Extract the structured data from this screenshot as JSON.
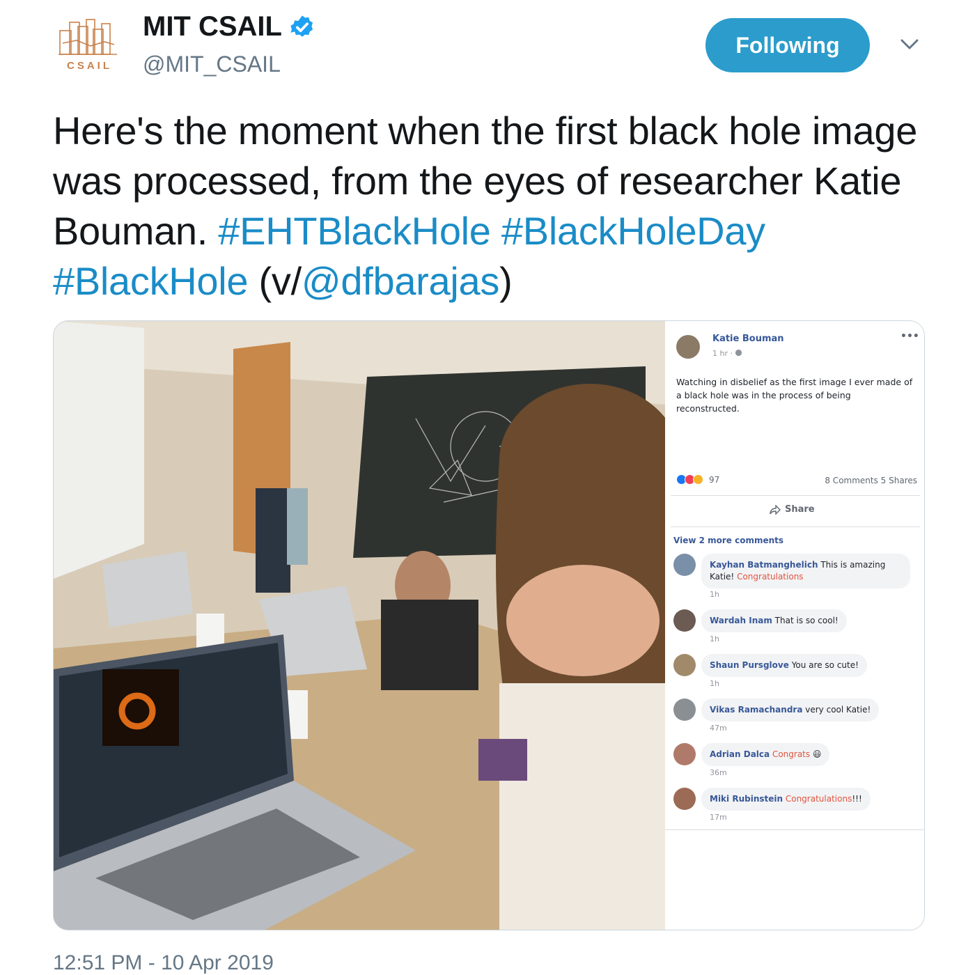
{
  "account": {
    "logo_text": "CSAIL",
    "display_name": "MIT CSAIL",
    "handle": "@MIT_CSAIL",
    "verified_icon": "verified-badge-icon",
    "follow_label": "Following"
  },
  "tweet": {
    "text_plain_1": "Here's the moment when the first black hole image was processed, from the eyes of researcher Katie Bouman. ",
    "hashtag_1": "#EHTBlackHole",
    "hashtag_2": "#BlackHoleDay",
    "hashtag_3": "#BlackHole",
    "text_via_open": " (v/",
    "mention": "@dfbarajas",
    "text_via_close": ")",
    "timestamp": "12:51 PM - 10 Apr 2019"
  },
  "fb_post": {
    "author": "Katie Bouman",
    "time": "1 hr · ",
    "more": "•••",
    "body": "Watching in disbelief as the first image I ever made of a black hole was in the process of being reconstructed.",
    "reaction_count": "97",
    "stats": "8 Comments  5 Shares",
    "share_label": "Share",
    "view_more": "View 2 more comments",
    "comments": [
      {
        "name": "Kayhan Batmanghelich",
        "text": "This is amazing Katie!",
        "red": "Congratulations",
        "time": "1h"
      },
      {
        "name": "Wardah Inam",
        "text": "That is so cool!",
        "red": "",
        "time": "1h"
      },
      {
        "name": "Shaun Pursglove",
        "text": "You are so cute!",
        "red": "",
        "time": "1h"
      },
      {
        "name": "Vikas Ramachandra",
        "text": "very cool Katie!",
        "red": "",
        "time": "47m"
      },
      {
        "name": "Adrian Dalca",
        "text": "",
        "red": "Congrats",
        "emoji": "😃",
        "time": "36m"
      },
      {
        "name": "Miki Rubinstein",
        "text": "",
        "red": "Congratulations",
        "tail": "!!!",
        "time": "17m"
      }
    ]
  },
  "colors": {
    "brand_blue": "#1da1f2",
    "follow_bg": "#2b9ccc",
    "fb_link": "#385898",
    "fb_red": "#e0543f"
  }
}
